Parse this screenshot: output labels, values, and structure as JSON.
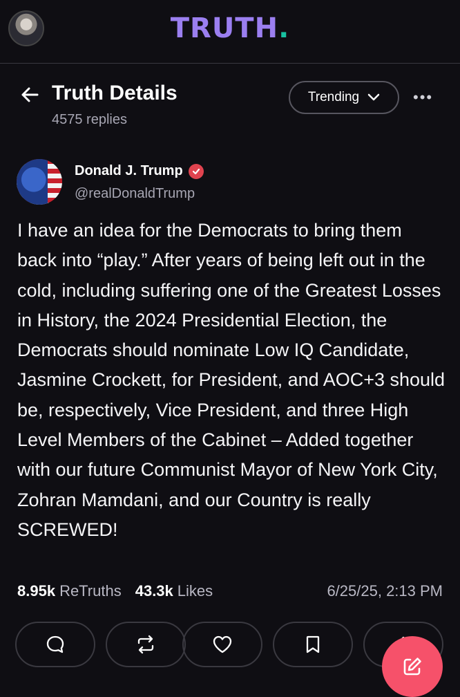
{
  "header": {
    "logo_main": "TRUTH",
    "logo_dot": "."
  },
  "details": {
    "title": "Truth Details",
    "replies": "4575 replies",
    "sort_label": "Trending"
  },
  "post": {
    "author_name": "Donald J. Trump",
    "handle": "@realDonaldTrump",
    "text": "I have an idea for the Democrats to bring them back into “play.” After years of being left out in the cold, including suffering one of the Greatest Losses in History, the 2024 Presidential Election, the Democrats should nominate Low IQ Candidate, Jasmine Crockett, for President, and AOC+3 should be, respectively, Vice President, and three High Level Members of the Cabinet – Added together with our future Communist Mayor of New York City, Zohran Mamdani, and our Country is really SCREWED!",
    "retruths_count": "8.95k",
    "retruths_label": "ReTruths",
    "likes_count": "43.3k",
    "likes_label": "Likes",
    "timestamp": "6/25/25, 2:13 PM"
  },
  "actions": [
    {
      "icon": "reply-icon"
    },
    {
      "icon": "retruth-icon"
    },
    {
      "icon": "like-icon"
    },
    {
      "icon": "bookmark-icon"
    },
    {
      "icon": "share-icon"
    }
  ],
  "colors": {
    "background": "#0f0e13",
    "logo": "#9b7ff0",
    "logo_dot": "#18c1a1",
    "verified": "#e0434f",
    "fab": "#f6516a"
  }
}
